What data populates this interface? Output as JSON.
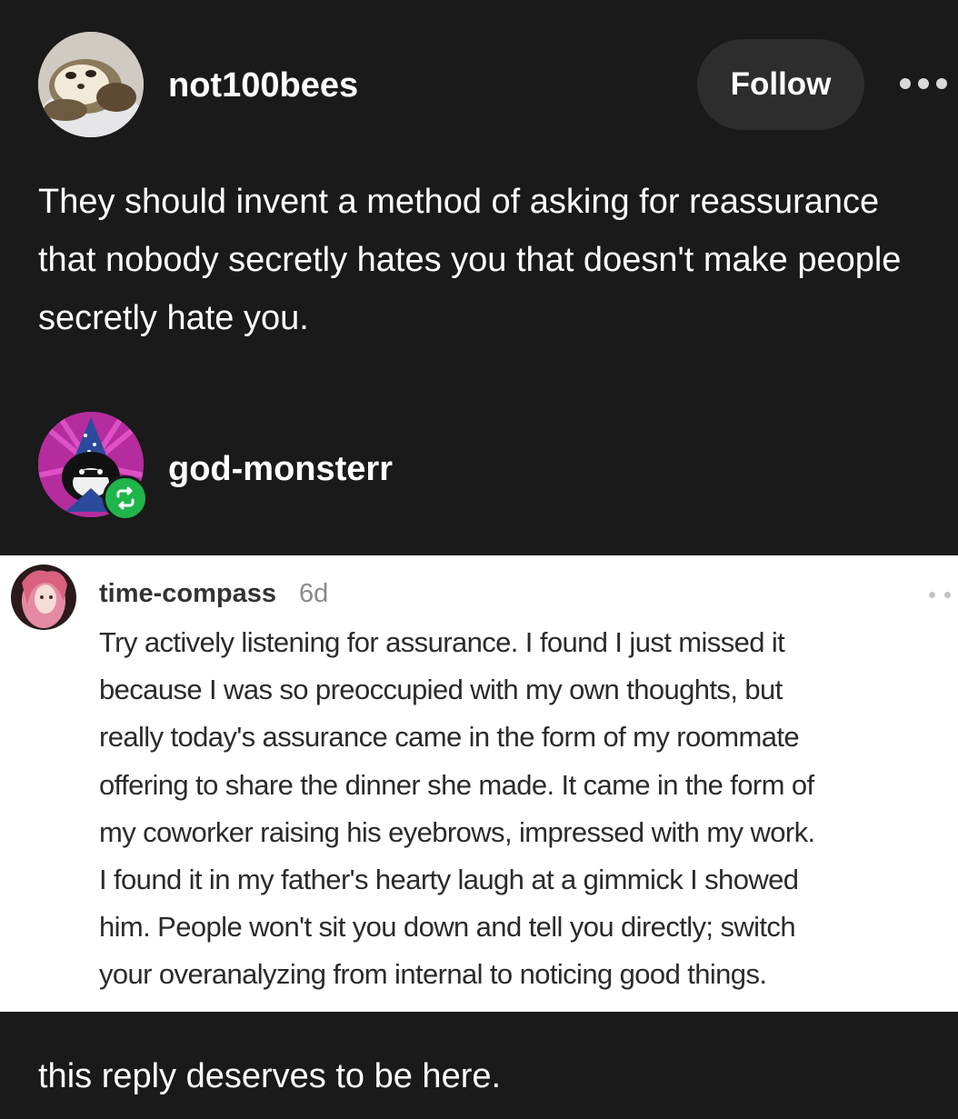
{
  "original_post": {
    "username": "not100bees",
    "follow_label": "Follow",
    "more_icon": "ellipsis-icon",
    "text": "They should invent a method of asking for reassurance that nobody secretly hates you that doesn't make people secretly hate you."
  },
  "reblog": {
    "username": "god-monsterr",
    "badge_icon": "reblog-icon",
    "badge_color": "#1fb54a"
  },
  "embedded_reply": {
    "username": "time-compass",
    "timestamp": "6d",
    "lines": [
      "Try actively listening for assurance. I found I just missed it",
      "because I was so preoccupied with my own thoughts, but",
      "really today's assurance came in the form of my roommate",
      "offering to share the dinner she made. It came in the form of",
      "my coworker raising his eyebrows, impressed with my work.",
      "I found it in my father's hearty laugh at a gimmick I showed",
      "him. People won't sit you down and tell you directly; switch",
      "your overanalyzing from internal to noticing good things."
    ]
  },
  "comment": {
    "text": "this reply deserves to be here."
  },
  "colors": {
    "background": "#1a1a1a",
    "follow_button": "#2d2d2d",
    "embed_background": "#ffffff"
  }
}
